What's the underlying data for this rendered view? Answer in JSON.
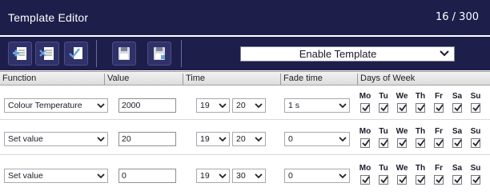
{
  "app": {
    "title": "Template Editor",
    "counter": "16 / 300"
  },
  "toolbar": {
    "buttons": [
      "add-row-icon",
      "delete-row-icon",
      "copy-row-icon",
      "save-icon",
      "save-as-icon"
    ],
    "template_select": "Enable Template"
  },
  "columns": {
    "function": "Function",
    "value": "Value",
    "time": "Time",
    "fade": "Fade time",
    "days": "Days of Week"
  },
  "days": [
    "Mo",
    "Tu",
    "We",
    "Th",
    "Fr",
    "Sa",
    "Su"
  ],
  "rows": [
    {
      "function": "Colour Temperature",
      "value": "2000",
      "hour": "19",
      "minute": "20",
      "fade": "1 s",
      "days_checked": [
        true,
        true,
        true,
        true,
        true,
        true,
        true
      ]
    },
    {
      "function": "Set value",
      "value": "20",
      "hour": "19",
      "minute": "20",
      "fade": "0",
      "days_checked": [
        true,
        true,
        true,
        true,
        true,
        true,
        true
      ]
    },
    {
      "function": "Set value",
      "value": "0",
      "hour": "19",
      "minute": "30",
      "fade": "0",
      "days_checked": [
        true,
        true,
        true,
        true,
        true,
        true,
        true
      ]
    }
  ],
  "colors": {
    "header_bg": "#1d1e4a",
    "button_bg": "#2f3168"
  }
}
